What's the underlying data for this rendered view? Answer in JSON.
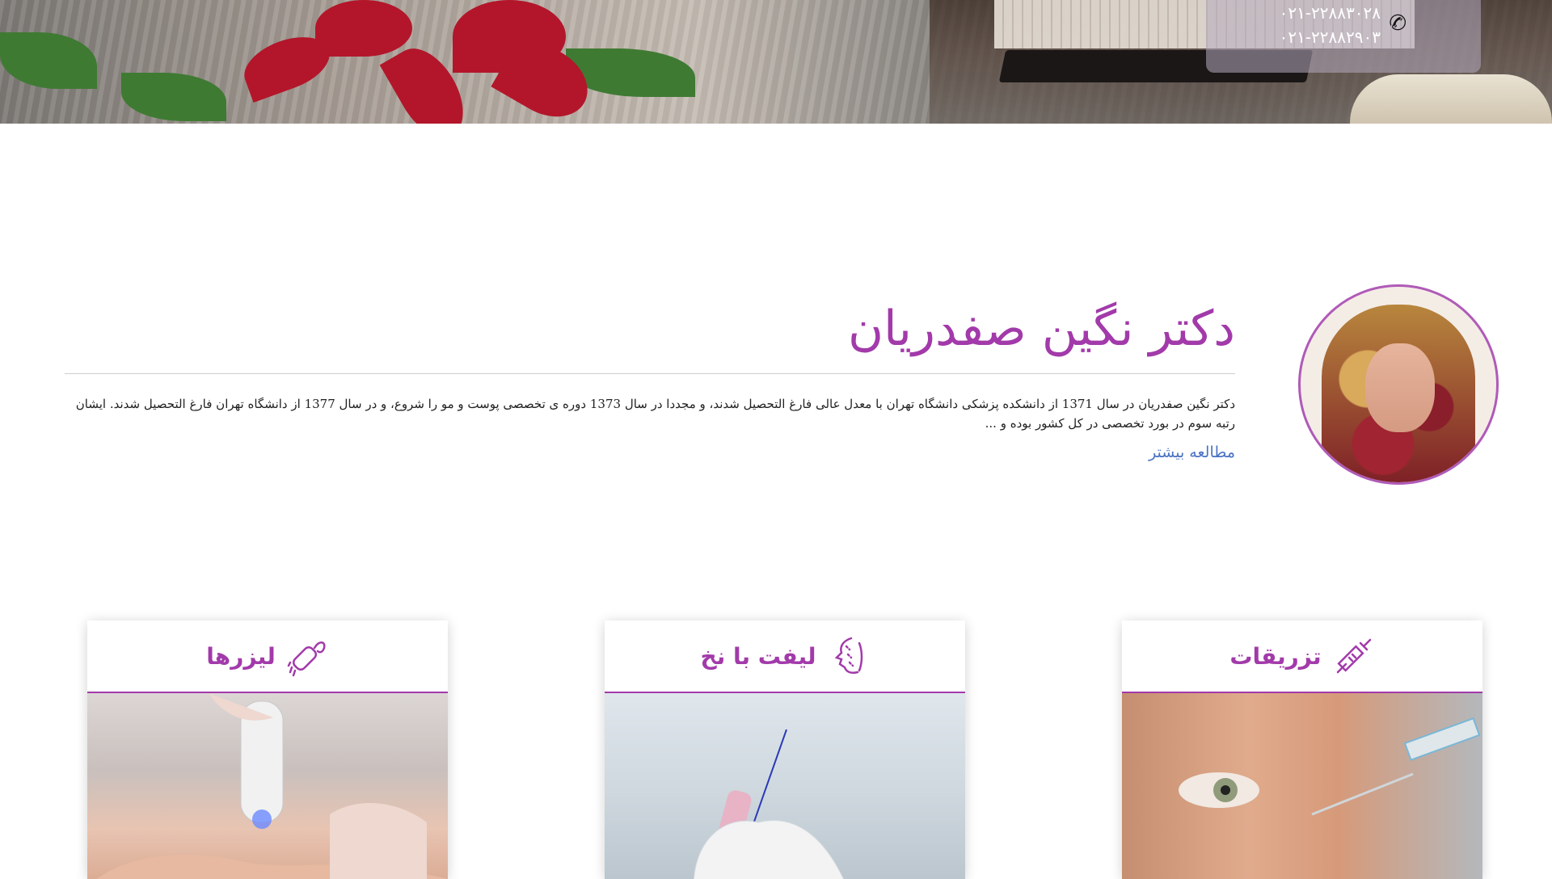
{
  "header": {
    "phones": [
      "۰۲۱-۲۲۸۸۳۰۲۸",
      "۰۲۱-۲۲۸۸۲۹۰۳"
    ],
    "phone_icon": "phone-icon"
  },
  "doctor": {
    "name": "دکتر نگین صفدریان",
    "bio": "دکتر نگین صفدریان در سال 1371 از دانشکده پزشکی دانشگاه تهران با معدل عالی فارغ التحصیل شدند، و مجددا در سال 1373 دوره ی تخصصی پوست و مو را شروع، و در سال 1377 از دانشگاه تهران فارغ التحصیل شدند. ایشان رتبه سوم در بورد تخصصی در کل کشور بوده و ...",
    "read_more": "مطالعه بیشتر"
  },
  "services": [
    {
      "title": "تزریقات",
      "icon": "syringe-icon"
    },
    {
      "title": "لیفت با نخ",
      "icon": "face-thread-icon"
    },
    {
      "title": "لیزرها",
      "icon": "laser-device-icon"
    }
  ],
  "colors": {
    "brand": "#a23aaa",
    "link": "#4a73c4"
  }
}
